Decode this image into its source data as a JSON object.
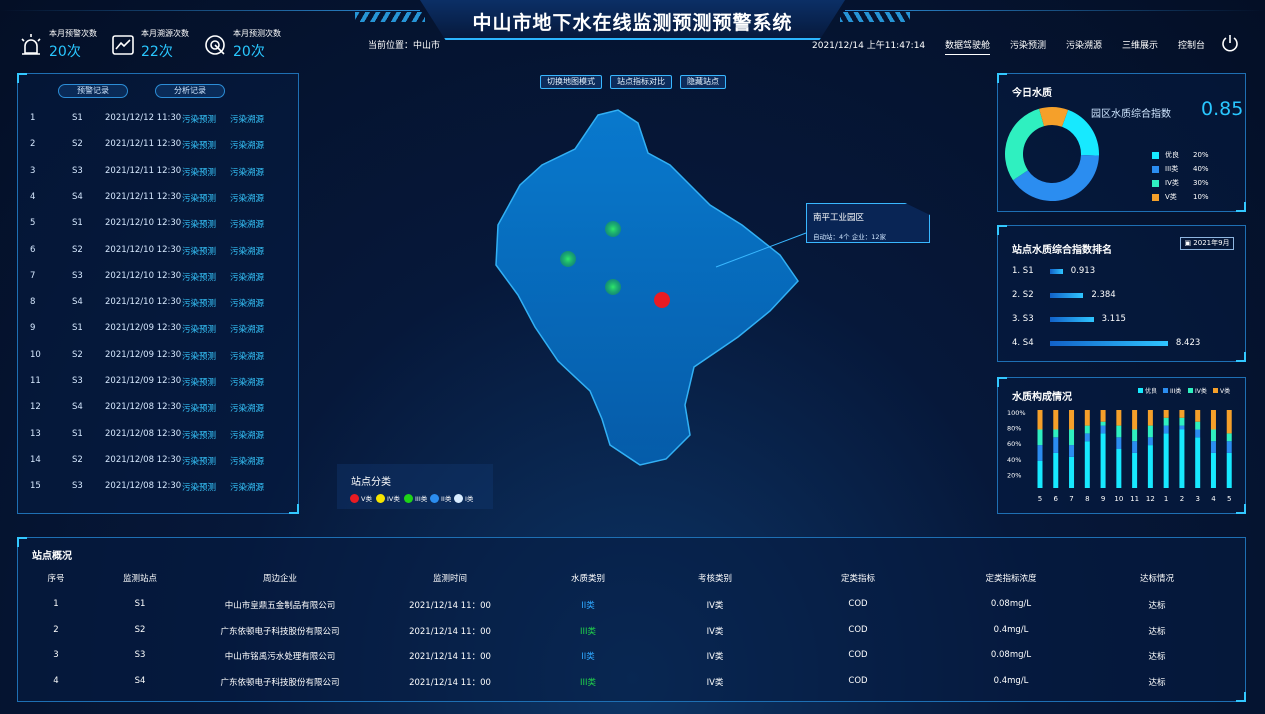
{
  "header": {
    "title": "中山市地下水在线监测预测预警系统",
    "location_label": "当前位置：中山市",
    "datetime": "2021/12/14 上午11:47:14",
    "stats": [
      {
        "label": "本月预警次数",
        "value": "20次",
        "icon": "alarm-light-icon"
      },
      {
        "label": "本月溯源次数",
        "value": "22次",
        "icon": "trend-chart-icon"
      },
      {
        "label": "本月预测次数",
        "value": "20次",
        "icon": "target-icon"
      }
    ],
    "nav": [
      "数据驾驶舱",
      "污染预测",
      "污染溯源",
      "三维展示",
      "控制台"
    ],
    "nav_active": 0
  },
  "records": {
    "tab_warning": "预警记录",
    "tab_analysis": "分析记录",
    "rows": [
      {
        "no": "1",
        "site": "S1",
        "time": "2021/12/12 11:30",
        "a1": "污染预测",
        "a2": "污染溯源"
      },
      {
        "no": "2",
        "site": "S2",
        "time": "2021/12/11 12:30",
        "a1": "污染预测",
        "a2": "污染溯源"
      },
      {
        "no": "3",
        "site": "S3",
        "time": "2021/12/11 12:30",
        "a1": "污染预测",
        "a2": "污染溯源"
      },
      {
        "no": "4",
        "site": "S4",
        "time": "2021/12/11 12:30",
        "a1": "污染预测",
        "a2": "污染溯源"
      },
      {
        "no": "5",
        "site": "S1",
        "time": "2021/12/10 12:30",
        "a1": "污染预测",
        "a2": "污染溯源"
      },
      {
        "no": "6",
        "site": "S2",
        "time": "2021/12/10 12:30",
        "a1": "污染预测",
        "a2": "污染溯源"
      },
      {
        "no": "7",
        "site": "S3",
        "time": "2021/12/10 12:30",
        "a1": "污染预测",
        "a2": "污染溯源"
      },
      {
        "no": "8",
        "site": "S4",
        "time": "2021/12/10 12:30",
        "a1": "污染预测",
        "a2": "污染溯源"
      },
      {
        "no": "9",
        "site": "S1",
        "time": "2021/12/09 12:30",
        "a1": "污染预测",
        "a2": "污染溯源"
      },
      {
        "no": "10",
        "site": "S2",
        "time": "2021/12/09 12:30",
        "a1": "污染预测",
        "a2": "污染溯源"
      },
      {
        "no": "11",
        "site": "S3",
        "time": "2021/12/09 12:30",
        "a1": "污染预测",
        "a2": "污染溯源"
      },
      {
        "no": "12",
        "site": "S4",
        "time": "2021/12/08 12:30",
        "a1": "污染预测",
        "a2": "污染溯源"
      },
      {
        "no": "13",
        "site": "S1",
        "time": "2021/12/08 12:30",
        "a1": "污染预测",
        "a2": "污染溯源"
      },
      {
        "no": "14",
        "site": "S2",
        "time": "2021/12/08 12:30",
        "a1": "污染预测",
        "a2": "污染溯源"
      },
      {
        "no": "15",
        "site": "S3",
        "time": "2021/12/08 12:30",
        "a1": "污染预测",
        "a2": "污染溯源"
      }
    ]
  },
  "map": {
    "buttons": [
      "切换地图模式",
      "站点指标对比",
      "隐藏站点"
    ],
    "callout_title": "南平工业园区",
    "callout_detail": "自动站：4个    企业：12家",
    "legend_title": "站点分类",
    "legend": [
      {
        "label": "V类",
        "color": "#e81b22"
      },
      {
        "label": "IV类",
        "color": "#f5e400"
      },
      {
        "label": "III类",
        "color": "#1fd317"
      },
      {
        "label": "II类",
        "color": "#2b8df0"
      },
      {
        "label": "I类",
        "color": "#d8ecff"
      }
    ]
  },
  "quality": {
    "title": "今日水质",
    "index_label": "园区水质综合指数",
    "index_value": "0.85",
    "chart_data": {
      "type": "pie",
      "series": [
        {
          "name": "优良",
          "value": 20,
          "color": "#17e9ff"
        },
        {
          "name": "III类",
          "value": 40,
          "color": "#2b8df0"
        },
        {
          "name": "IV类",
          "value": 30,
          "color": "#2ff0c0"
        },
        {
          "name": "V类",
          "value": 10,
          "color": "#f5a02a"
        }
      ],
      "legend_labels": [
        "20%",
        "40%",
        "30%",
        "10%"
      ],
      "legend": "right"
    }
  },
  "ranking": {
    "title": "站点水质综合指数排名",
    "date": "2021年9月",
    "chart_data": {
      "type": "bar",
      "categories": [
        "1. S1",
        "2. S2",
        "3. S3",
        "4. S4"
      ],
      "values": [
        0.913,
        2.384,
        3.115,
        8.423
      ],
      "value_labels": [
        "0.913",
        "2.384",
        "3.115",
        "8.423"
      ],
      "xlim": [
        0,
        10
      ]
    }
  },
  "composition": {
    "title": "水质构成情况",
    "chart_data": {
      "type": "bar",
      "stacked": true,
      "categories": [
        "5",
        "6",
        "7",
        "8",
        "9",
        "10",
        "11",
        "12",
        "1",
        "2",
        "3",
        "4",
        "5"
      ],
      "y_ticks": [
        "100%",
        "80%",
        "60%",
        "40%",
        "20%"
      ],
      "ylim": [
        0,
        100
      ],
      "series": [
        {
          "name": "优良",
          "color": "#17e9ff",
          "values": [
            35,
            45,
            40,
            60,
            70,
            50,
            45,
            55,
            70,
            75,
            65,
            45,
            45
          ]
        },
        {
          "name": "III类",
          "color": "#2b8df0",
          "values": [
            20,
            20,
            15,
            10,
            10,
            15,
            15,
            10,
            10,
            5,
            10,
            15,
            15
          ]
        },
        {
          "name": "IV类",
          "color": "#2ff0c0",
          "values": [
            20,
            10,
            20,
            10,
            5,
            15,
            15,
            15,
            10,
            10,
            10,
            15,
            10
          ]
        },
        {
          "name": "V类",
          "color": "#f5a02a",
          "values": [
            25,
            25,
            25,
            20,
            15,
            20,
            25,
            20,
            10,
            10,
            15,
            25,
            30
          ]
        }
      ],
      "legend": "top-right"
    }
  },
  "sites": {
    "title": "站点概况",
    "columns": [
      "序号",
      "监测站点",
      "周边企业",
      "监测时间",
      "水质类别",
      "考核类别",
      "定类指标",
      "定类指标浓度",
      "达标情况"
    ],
    "rows": [
      {
        "no": "1",
        "site": "S1",
        "company": "中山市皇鼎五金制品有限公司",
        "time": "2021/12/14 11：00",
        "quality": "II类",
        "quality_color": "#2fa8ff",
        "assess": "IV类",
        "indicator": "COD",
        "conc": "0.08mg/L",
        "status": "达标"
      },
      {
        "no": "2",
        "site": "S2",
        "company": "广东依顿电子科技股份有限公司",
        "time": "2021/12/14 11：00",
        "quality": "III类",
        "quality_color": "#21d14a",
        "assess": "IV类",
        "indicator": "COD",
        "conc": "0.4mg/L",
        "status": "达标"
      },
      {
        "no": "3",
        "site": "S3",
        "company": "中山市铭禹污水处理有限公司",
        "time": "2021/12/14 11：00",
        "quality": "II类",
        "quality_color": "#2fa8ff",
        "assess": "IV类",
        "indicator": "COD",
        "conc": "0.08mg/L",
        "status": "达标"
      },
      {
        "no": "4",
        "site": "S4",
        "company": "广东依顿电子科技股份有限公司",
        "time": "2021/12/14 11：00",
        "quality": "III类",
        "quality_color": "#21d14a",
        "assess": "IV类",
        "indicator": "COD",
        "conc": "0.4mg/L",
        "status": "达标"
      }
    ]
  }
}
